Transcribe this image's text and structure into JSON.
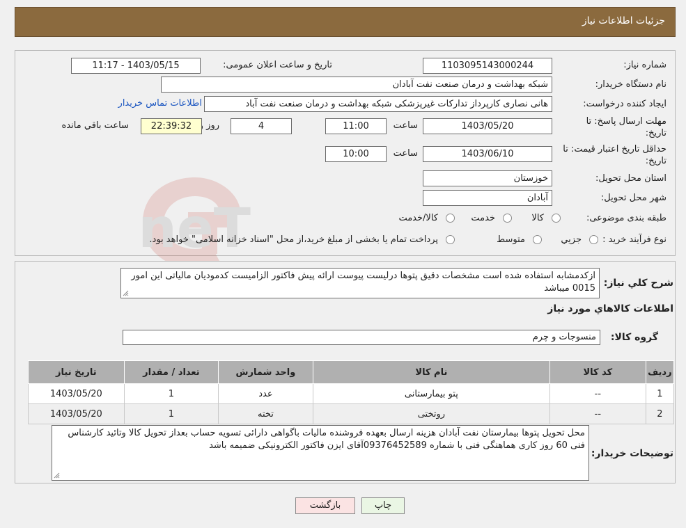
{
  "header": {
    "title": "جزئیات اطلاعات نیاز"
  },
  "form": {
    "need_number_label": "شماره نیاز:",
    "need_number": "1103095143000244",
    "announce_label": "تاریخ و ساعت اعلان عمومی:",
    "announce_value": "1403/05/15 - 11:17",
    "buyer_org_label": "نام دستگاه خریدار:",
    "buyer_org": "شبکه بهداشت و درمان صنعت نفت آبادان",
    "requester_label": "ایجاد کننده درخواست:",
    "requester": "هانی نصاری کارپرداز تدارکات غیرپزشکی شبکه بهداشت و درمان صنعت نفت آباد",
    "contact_link": "اطلاعات تماس خریدار",
    "deadline_label": "مهلت ارسال پاسخ: تا تاریخ:",
    "deadline_date": "1403/05/20",
    "time_label": "ساعت",
    "deadline_time": "11:00",
    "days_value": "4",
    "days_label": "روز و",
    "remaining_time": "22:39:32",
    "remaining_label": "ساعت باقي مانده",
    "validity_label": "حداقل تاریخ اعتبار قیمت: تا تاریخ:",
    "validity_date": "1403/06/10",
    "validity_time": "10:00",
    "province_label": "استان محل تحویل:",
    "province": "خوزستان",
    "city_label": "شهر محل تحویل:",
    "city": "آبادان",
    "category_label": "طبقه بندی موضوعی:",
    "category_options": [
      "کالا",
      "خدمت",
      "کالا/خدمت"
    ],
    "process_label": "نوع فرآیند خرید :",
    "process_options": [
      "جزیي",
      "متوسط"
    ],
    "process_note": "پرداخت تمام یا بخشی از مبلغ خرید،از محل \"اسناد خزانه اسلامی\" خواهد بود."
  },
  "details": {
    "desc_label": "شرح کلي نياز:",
    "desc_text": "ازکدمشابه استفاده شده است مشخصات دقیق پتوها درلیست پیوست ارائه پیش فاکتور الزامیست کدمودیان مالیاتی این امور 0015 میباشد",
    "goods_title": "اطلاعات کالاهاي مورد نياز",
    "group_label": "گروه کالا:",
    "group_value": "منسوجات و چرم"
  },
  "table": {
    "headers": [
      "رديف",
      "کد کالا",
      "نام کالا",
      "واحد شمارش",
      "تعداد / مقدار",
      "تاریخ نیاز"
    ],
    "rows": [
      [
        "1",
        "--",
        "پتو بیمارستانی",
        "عدد",
        "1",
        "1403/05/20"
      ],
      [
        "2",
        "--",
        "روتختی",
        "تخته",
        "1",
        "1403/05/20"
      ]
    ]
  },
  "buyer_notes": {
    "label": "توضیحات خریدار:",
    "text": "محل تحویل پتوها بیمارستان نفت آبادان هزینه ارسال بعهده فروشنده مالیات باگواهی دارائی تسویه حساب بعداز تحویل کالا وتائید کارشناس فنی 60 روز کاری هماهنگی فنی با شماره 09376452589آقای ایزن فاکتور الکترونیکی ضمیمه باشد"
  },
  "buttons": {
    "print": "چاپ",
    "back": "بازگشت"
  },
  "watermark": {
    "text": "AriaTender.neT"
  },
  "colors": {
    "header_bg": "#8b6a3e",
    "link": "#1a55c0",
    "back_btn": "#fbe3e3",
    "print_btn": "#eaf6e4"
  }
}
